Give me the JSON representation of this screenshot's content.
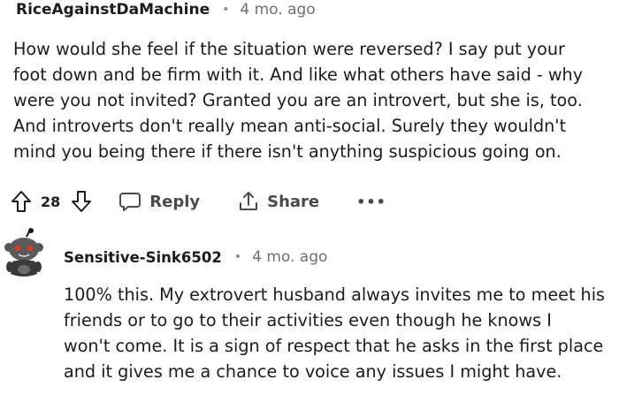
{
  "comment1": {
    "username": "RiceAgainstDaMachine",
    "separator": "•",
    "time": "4 mo. ago",
    "body_lines": [
      "How would she feel if the situation were reversed? I say put your",
      "foot down and be firm with it. And like what others have said - why",
      "were you not invited? Granted you are an introvert, but she is, too.",
      "And introverts don't really mean anti-social. Surely they wouldn't",
      "mind you being there if there isn't anything suspicious going on."
    ],
    "votes": "28",
    "reply_label": "Reply",
    "share_label": "Share",
    "more_label": "•••",
    "icons": [
      "upvote-icon",
      "downvote-icon",
      "reply-icon",
      "share-icon",
      "more-icon"
    ]
  },
  "comment2": {
    "username": "Sensitive-Sink6502",
    "separator": "•",
    "time": "4 mo. ago",
    "body_lines": [
      "100% this. My extrovert husband always invites me to meet his",
      "friends or to go to their activities even though he knows I",
      "won't come. It is a sign of respect that he asks in the first place",
      "and it gives me a chance to voice any issues I might have."
    ],
    "avatar_icon": "snoo-avatar-icon"
  },
  "colors": {
    "text": "#1c1c1c",
    "meta": "#6f6f6f",
    "action": "#4a4a4a"
  }
}
